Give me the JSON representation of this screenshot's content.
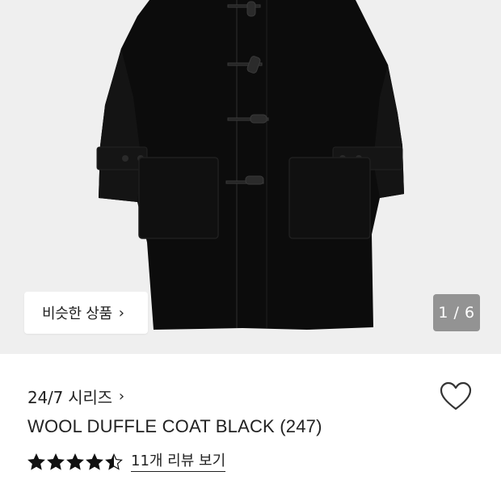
{
  "gallery": {
    "image_alt": "Black wool duffle coat",
    "similar_products_label": "비슷한 상품",
    "similar_products_chevron": "›",
    "pager_text": "1 / 6"
  },
  "product": {
    "series_label": "24/7 시리즈",
    "series_chevron": "›",
    "title": "WOOL DUFFLE COAT BLACK (247)",
    "rating": 4.5,
    "rating_max": 5,
    "review_link": "11개 리뷰 보기",
    "wishlist_icon": "heart-outline-icon"
  },
  "colors": {
    "star": "#111111",
    "gallery_bg": "#efefef",
    "coat": "#0c0c0c"
  }
}
